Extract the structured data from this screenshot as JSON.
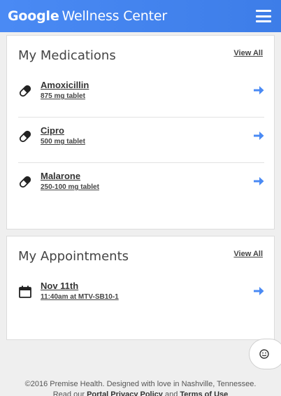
{
  "header": {
    "brand_google": "Google",
    "brand_name": "Wellness Center",
    "menu_icon": "hamburger-menu-icon"
  },
  "medications": {
    "title": "My Medications",
    "view_all": "View All",
    "items": [
      {
        "name": "Amoxicillin",
        "detail": "875 mg tablet",
        "icon": "pill-icon"
      },
      {
        "name": "Cipro",
        "detail": "500 mg tablet",
        "icon": "pill-icon"
      },
      {
        "name": "Malarone",
        "detail": "250-100 mg tablet",
        "icon": "pill-icon"
      }
    ]
  },
  "appointments": {
    "title": "My Appointments",
    "view_all": "View All",
    "items": [
      {
        "date": "Nov 11th",
        "detail": "11:40am at MTV-SB10-1",
        "icon": "calendar-icon"
      }
    ]
  },
  "colors": {
    "header_blue": "#4285f4",
    "arrow_blue": "#4a8af4"
  },
  "footer": {
    "copyright": "©2016 Premise Health. Designed with love in Nashville, Tennessee.",
    "read_our": "Read our",
    "privacy_link": "Portal Privacy Policy",
    "and": "and",
    "terms_link": "Terms of Use"
  },
  "feedback": {
    "icon": "smiley-face-icon"
  }
}
